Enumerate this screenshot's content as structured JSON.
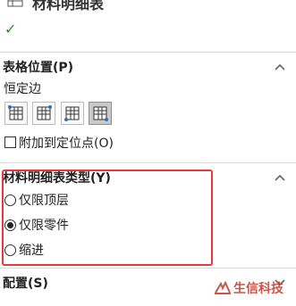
{
  "panel": {
    "title": "材料明细表",
    "ok_symbol": "✓"
  },
  "table_position": {
    "header": "表格位置(P)",
    "anchor_label": "恒定边",
    "anchor_buttons": [
      {
        "icon": "table-anchor-top-left-icon",
        "active": false
      },
      {
        "icon": "table-anchor-top-right-icon",
        "active": false
      },
      {
        "icon": "table-anchor-bottom-left-icon",
        "active": false
      },
      {
        "icon": "table-anchor-bottom-right-icon",
        "active": true
      }
    ],
    "attach_label": "附加到定位点(O)",
    "attach_checked": false
  },
  "bom_type": {
    "header": "材料明细表类型(Y)",
    "options": [
      {
        "label": "仅限顶层",
        "checked": false
      },
      {
        "label": "仅限零件",
        "checked": true
      },
      {
        "label": "缩进",
        "checked": false
      }
    ]
  },
  "configuration": {
    "header": "配置(S)"
  },
  "watermark": {
    "text": "生信科技"
  },
  "colors": {
    "highlight": "#e8383d",
    "check": "#2e8b2e",
    "watermark": "#c0392b"
  }
}
